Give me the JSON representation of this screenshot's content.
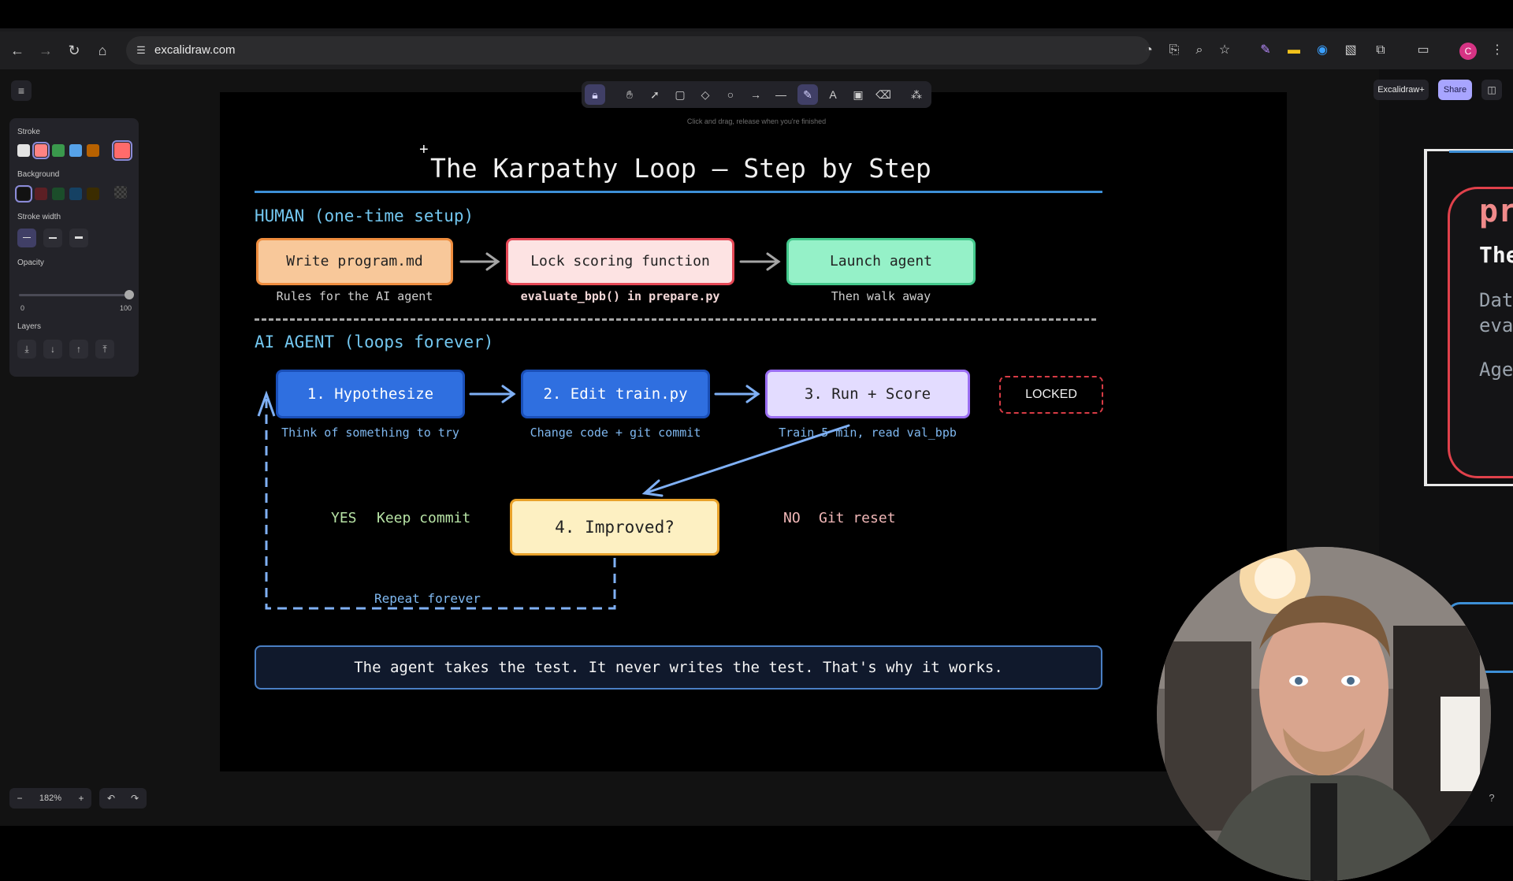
{
  "browser": {
    "url": "excalidraw.com",
    "profile_initial": "C"
  },
  "app": {
    "library_button": "Excalidraw+",
    "share_button": "Share",
    "toolbar_hint": "Click and drag, release when you're finished",
    "zoom_level": "182%"
  },
  "properties": {
    "stroke_label": "Stroke",
    "background_label": "Background",
    "stroke_width_label": "Stroke width",
    "opacity_label": "Opacity",
    "opacity_min": "0",
    "opacity_max": "100",
    "layers_label": "Layers",
    "stroke_colors": [
      "#e3e3e3",
      "#ff8383",
      "#3a994c",
      "#56a2e8",
      "#b76100"
    ],
    "stroke_selected": "#ff6b6b",
    "background_colors": [
      "#121212",
      "#5c1f24",
      "#1b4d2a",
      "#154163",
      "#3b2c00"
    ]
  },
  "diagram": {
    "title": "The Karpathy Loop — Step by Step",
    "human_section": "HUMAN (one-time setup)",
    "agent_section": "AI AGENT (loops forever)",
    "human_steps": [
      {
        "label": "Write program.md",
        "caption": "Rules for the AI agent"
      },
      {
        "label": "Lock scoring function",
        "caption": "evaluate_bpb() in prepare.py"
      },
      {
        "label": "Launch agent",
        "caption": "Then walk away"
      }
    ],
    "agent_steps": [
      {
        "label": "1. Hypothesize",
        "caption": "Think of something to try"
      },
      {
        "label": "2. Edit train.py",
        "caption": "Change code + git commit"
      },
      {
        "label": "3. Run + Score",
        "caption": "Train 5 min, read val_bpb"
      }
    ],
    "locked_badge": "LOCKED",
    "decision": "4. Improved?",
    "yes_label": "YES",
    "yes_action": "Keep commit",
    "no_label": "NO",
    "no_action": "Git reset",
    "repeat_label": "Repeat forever",
    "bottom_note": "The agent takes the test. It never writes the test. That's why it works.",
    "peek_lines": [
      "pr",
      "The",
      "Dat",
      "eva",
      "Age"
    ]
  }
}
